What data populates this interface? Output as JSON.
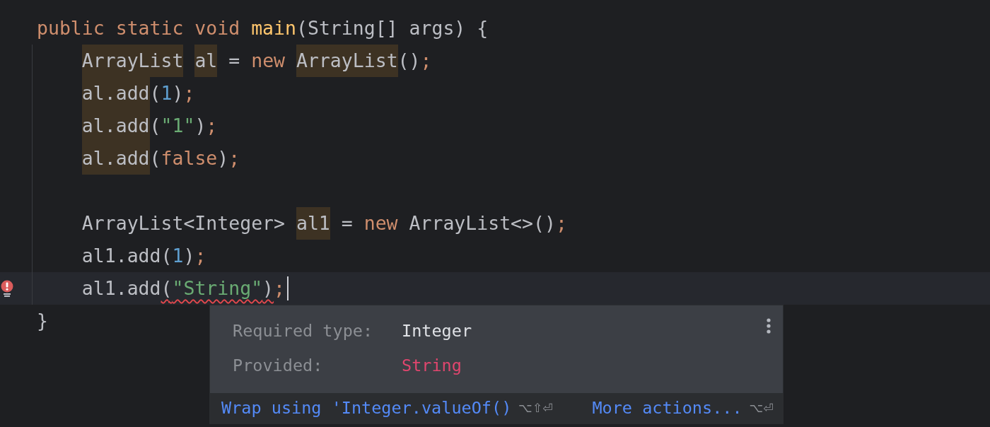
{
  "editor": {
    "lines": [
      {
        "kind": "code",
        "tokens": [
          {
            "text": "public static void ",
            "kind": "keyword"
          },
          {
            "text": "main",
            "kind": "method"
          },
          {
            "text": "(String[] args) {",
            "kind": "plain"
          }
        ],
        "children": [
          {
            "kind": "code",
            "tokens": [
              {
                "text": "ArrayList ",
                "kind": "plain",
                "highlighted": true
              },
              {
                "text": "al",
                "kind": "plain",
                "highlighted": true
              },
              {
                "text": " = ",
                "kind": "plain"
              },
              {
                "text": "new ",
                "kind": "keyword"
              },
              {
                "text": "ArrayList",
                "kind": "plain",
                "highlighted": true
              },
              {
                "text": "()",
                "kind": "plain"
              },
              {
                "text": ";",
                "kind": "semicolon"
              }
            ]
          },
          {
            "kind": "code",
            "tokens": [
              {
                "text": "al.add",
                "kind": "plain",
                "highlighted": true
              },
              {
                "text": "(",
                "kind": "plain"
              },
              {
                "text": "1",
                "kind": "number"
              },
              {
                "text": ")",
                "kind": "plain"
              },
              {
                "text": ";",
                "kind": "semicolon"
              }
            ]
          },
          {
            "kind": "code",
            "tokens": [
              {
                "text": "al.add",
                "kind": "plain",
                "highlighted": true
              },
              {
                "text": "(",
                "kind": "plain"
              },
              {
                "text": "\"1\"",
                "kind": "string"
              },
              {
                "text": ")",
                "kind": "plain"
              },
              {
                "text": ";",
                "kind": "semicolon"
              }
            ]
          },
          {
            "kind": "code",
            "tokens": [
              {
                "text": "al.add",
                "kind": "plain",
                "highlighted": true
              },
              {
                "text": "(",
                "kind": "plain"
              },
              {
                "text": "false",
                "kind": "keyword"
              },
              {
                "text": ")",
                "kind": "plain"
              },
              {
                "text": ";",
                "kind": "semicolon"
              }
            ]
          },
          {
            "kind": "blank"
          },
          {
            "kind": "code",
            "tokens": [
              {
                "text": "ArrayList<Integer> ",
                "kind": "plain"
              },
              {
                "text": "al1",
                "kind": "plain",
                "highlighted": true
              },
              {
                "text": " = ",
                "kind": "plain"
              },
              {
                "text": "new ",
                "kind": "keyword"
              },
              {
                "text": "ArrayList<>()",
                "kind": "plain"
              },
              {
                "text": ";",
                "kind": "semicolon"
              }
            ]
          },
          {
            "kind": "code",
            "tokens": [
              {
                "text": "al1.add(",
                "kind": "plain"
              },
              {
                "text": "1",
                "kind": "number"
              },
              {
                "text": ")",
                "kind": "plain"
              },
              {
                "text": ";",
                "kind": "semicolon"
              }
            ]
          },
          {
            "kind": "code",
            "current": true,
            "error": true,
            "tokens": [
              {
                "text": "al1.add",
                "kind": "plain"
              },
              {
                "text": "(",
                "kind": "plain",
                "squiggle": true
              },
              {
                "text": "\"String\"",
                "kind": "string",
                "squiggle": true
              },
              {
                "text": ")",
                "kind": "plain",
                "squiggle": true
              },
              {
                "text": ";",
                "kind": "semicolon"
              }
            ]
          }
        ]
      },
      {
        "kind": "code",
        "tokens": [
          {
            "text": "}",
            "kind": "plain"
          }
        ]
      }
    ]
  },
  "popup": {
    "rows": [
      {
        "label": "Required type:",
        "value": "Integer",
        "kind": "required"
      },
      {
        "label": "Provided:",
        "value": "String",
        "kind": "provided"
      }
    ],
    "actions": [
      {
        "label": "Wrap using 'Integer.valueOf()",
        "shortcut": "⌥⇧⏎"
      },
      {
        "label": "More actions...",
        "shortcut": "⌥⏎"
      }
    ]
  }
}
